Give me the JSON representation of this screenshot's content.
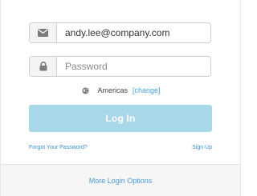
{
  "email_field": {
    "icon": "envelope-icon",
    "value": "andy.lee@company.com"
  },
  "password_field": {
    "icon": "lock-icon",
    "placeholder": "Password",
    "value": ""
  },
  "region": {
    "icon": "globe-icon",
    "name": "Americas",
    "change_label": "[change]"
  },
  "login_button": {
    "label": "Log In"
  },
  "links": {
    "forgot_password": "Forgot Your Password?",
    "sign_up": "Sign Up"
  },
  "footer": {
    "more_options": "More Login Options"
  },
  "colors": {
    "accent": "#a8d7ea",
    "link": "#4aa3df",
    "border": "#cfcfcf",
    "icon": "#7b7b7b"
  }
}
